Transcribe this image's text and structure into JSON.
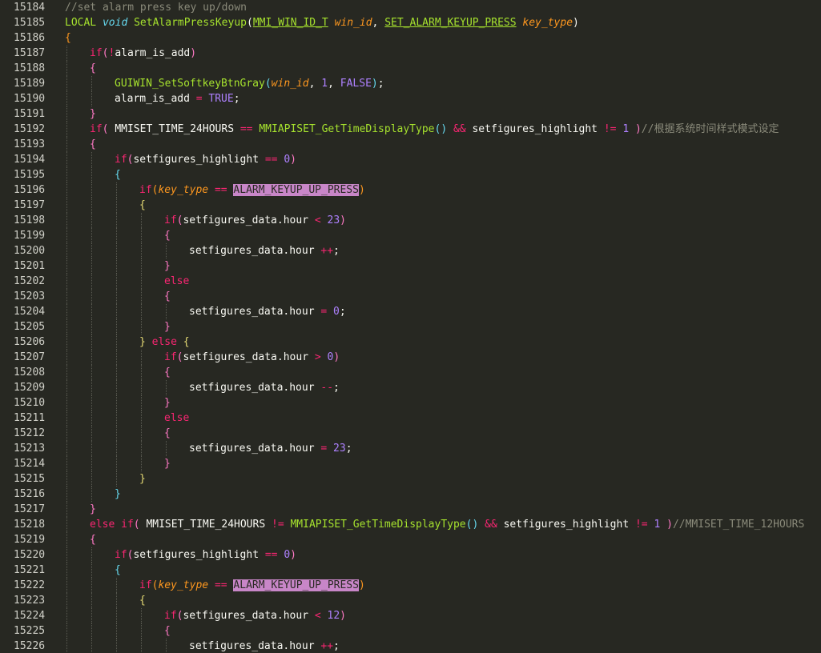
{
  "editor": {
    "lines": [
      {
        "num": "15184",
        "indent": 0,
        "tokens": [
          {
            "t": "//set alarm press key up/down",
            "c": "c"
          }
        ]
      },
      {
        "num": "15185",
        "indent": 0,
        "tokens": [
          {
            "t": "LOCAL ",
            "c": "f"
          },
          {
            "t": "void ",
            "c": "t"
          },
          {
            "t": "SetAlarmPressKeyup",
            "c": "f"
          },
          {
            "t": "(",
            "c": "w"
          },
          {
            "t": "MMI_WIN_ID_T",
            "c": "tu"
          },
          {
            "t": " ",
            "c": "w"
          },
          {
            "t": "win_id",
            "c": "p"
          },
          {
            "t": ", ",
            "c": "w"
          },
          {
            "t": "SET_ALARM_KEYUP_PRESS",
            "c": "tu"
          },
          {
            "t": " ",
            "c": "w"
          },
          {
            "t": "key_type",
            "c": "p"
          },
          {
            "t": ")",
            "c": "w"
          }
        ]
      },
      {
        "num": "15186",
        "indent": 0,
        "tokens": [
          {
            "t": "{",
            "c": "b"
          }
        ]
      },
      {
        "num": "15187",
        "indent": 1,
        "tokens": [
          {
            "t": "if",
            "c": "k"
          },
          {
            "t": "(",
            "c": "b2"
          },
          {
            "t": "!",
            "c": "k"
          },
          {
            "t": "alarm_is_add",
            "c": "w"
          },
          {
            "t": ")",
            "c": "b2"
          }
        ]
      },
      {
        "num": "15188",
        "indent": 1,
        "tokens": [
          {
            "t": "{",
            "c": "b2"
          }
        ]
      },
      {
        "num": "15189",
        "indent": 2,
        "tokens": [
          {
            "t": "GUIWIN_SetSoftkeyBtnGray",
            "c": "f"
          },
          {
            "t": "(",
            "c": "b3"
          },
          {
            "t": "win_id",
            "c": "p"
          },
          {
            "t": ", ",
            "c": "w"
          },
          {
            "t": "1",
            "c": "n"
          },
          {
            "t": ", ",
            "c": "w"
          },
          {
            "t": "FALSE",
            "c": "n"
          },
          {
            "t": ")",
            "c": "b3"
          },
          {
            "t": ";",
            "c": "w"
          }
        ]
      },
      {
        "num": "15190",
        "indent": 2,
        "tokens": [
          {
            "t": "alarm_is_add ",
            "c": "w"
          },
          {
            "t": "=",
            "c": "k"
          },
          {
            "t": " ",
            "c": "w"
          },
          {
            "t": "TRUE",
            "c": "n"
          },
          {
            "t": ";",
            "c": "w"
          }
        ]
      },
      {
        "num": "15191",
        "indent": 1,
        "tokens": [
          {
            "t": "}",
            "c": "b2"
          }
        ]
      },
      {
        "num": "15192",
        "indent": 1,
        "tokens": [
          {
            "t": "if",
            "c": "k"
          },
          {
            "t": "( ",
            "c": "b2"
          },
          {
            "t": "MMISET_TIME_24HOURS ",
            "c": "w"
          },
          {
            "t": "==",
            "c": "k"
          },
          {
            "t": " ",
            "c": "w"
          },
          {
            "t": "MMIAPISET_GetTimeDisplayType",
            "c": "f"
          },
          {
            "t": "()",
            "c": "b3"
          },
          {
            "t": " ",
            "c": "w"
          },
          {
            "t": "&&",
            "c": "k"
          },
          {
            "t": " setfigures_highlight ",
            "c": "w"
          },
          {
            "t": "!=",
            "c": "k"
          },
          {
            "t": " ",
            "c": "w"
          },
          {
            "t": "1",
            "c": "n"
          },
          {
            "t": " )",
            "c": "b2"
          },
          {
            "t": "//根据系统时间样式模式设定",
            "c": "c"
          }
        ]
      },
      {
        "num": "15193",
        "indent": 1,
        "tokens": [
          {
            "t": "{",
            "c": "b2"
          }
        ]
      },
      {
        "num": "15194",
        "indent": 2,
        "tokens": [
          {
            "t": "if",
            "c": "k"
          },
          {
            "t": "(",
            "c": "b2"
          },
          {
            "t": "setfigures_highlight ",
            "c": "w"
          },
          {
            "t": "==",
            "c": "k"
          },
          {
            "t": " ",
            "c": "w"
          },
          {
            "t": "0",
            "c": "n"
          },
          {
            "t": ")",
            "c": "b2"
          }
        ]
      },
      {
        "num": "15195",
        "indent": 2,
        "tokens": [
          {
            "t": "{",
            "c": "b3"
          }
        ]
      },
      {
        "num": "15196",
        "indent": 3,
        "tokens": [
          {
            "t": "if",
            "c": "k"
          },
          {
            "t": "(",
            "c": "b"
          },
          {
            "t": "key_type",
            "c": "p"
          },
          {
            "t": " ",
            "c": "w"
          },
          {
            "t": "==",
            "c": "k"
          },
          {
            "t": " ",
            "c": "w"
          },
          {
            "t": "ALARM_KEYUP_UP_PRESS",
            "c": "hl"
          },
          {
            "t": ")",
            "c": "b"
          }
        ]
      },
      {
        "num": "15197",
        "indent": 3,
        "tokens": [
          {
            "t": "{",
            "c": "b4"
          }
        ]
      },
      {
        "num": "15198",
        "indent": 4,
        "tokens": [
          {
            "t": "if",
            "c": "k"
          },
          {
            "t": "(",
            "c": "b2"
          },
          {
            "t": "setfigures_data.hour ",
            "c": "w"
          },
          {
            "t": "<",
            "c": "k"
          },
          {
            "t": " ",
            "c": "w"
          },
          {
            "t": "23",
            "c": "n"
          },
          {
            "t": ")",
            "c": "b2"
          }
        ]
      },
      {
        "num": "15199",
        "indent": 4,
        "tokens": [
          {
            "t": "{",
            "c": "b2"
          }
        ]
      },
      {
        "num": "15200",
        "indent": 5,
        "tokens": [
          {
            "t": "setfigures_data.hour ",
            "c": "w"
          },
          {
            "t": "++",
            "c": "k"
          },
          {
            "t": ";",
            "c": "w"
          }
        ]
      },
      {
        "num": "15201",
        "indent": 4,
        "tokens": [
          {
            "t": "}",
            "c": "b2"
          }
        ]
      },
      {
        "num": "15202",
        "indent": 4,
        "tokens": [
          {
            "t": "else",
            "c": "k"
          }
        ]
      },
      {
        "num": "15203",
        "indent": 4,
        "tokens": [
          {
            "t": "{",
            "c": "b2"
          }
        ]
      },
      {
        "num": "15204",
        "indent": 5,
        "tokens": [
          {
            "t": "setfigures_data.hour ",
            "c": "w"
          },
          {
            "t": "=",
            "c": "k"
          },
          {
            "t": " ",
            "c": "w"
          },
          {
            "t": "0",
            "c": "n"
          },
          {
            "t": ";",
            "c": "w"
          }
        ]
      },
      {
        "num": "15205",
        "indent": 4,
        "tokens": [
          {
            "t": "}",
            "c": "b2"
          }
        ]
      },
      {
        "num": "15206",
        "indent": 3,
        "tokens": [
          {
            "t": "}",
            "c": "b4"
          },
          {
            "t": " ",
            "c": "w"
          },
          {
            "t": "else",
            "c": "k"
          },
          {
            "t": " ",
            "c": "w"
          },
          {
            "t": "{",
            "c": "b4"
          }
        ]
      },
      {
        "num": "15207",
        "indent": 4,
        "tokens": [
          {
            "t": "if",
            "c": "k"
          },
          {
            "t": "(",
            "c": "b2"
          },
          {
            "t": "setfigures_data.hour ",
            "c": "w"
          },
          {
            "t": ">",
            "c": "k"
          },
          {
            "t": " ",
            "c": "w"
          },
          {
            "t": "0",
            "c": "n"
          },
          {
            "t": ")",
            "c": "b2"
          }
        ]
      },
      {
        "num": "15208",
        "indent": 4,
        "tokens": [
          {
            "t": "{",
            "c": "b2"
          }
        ]
      },
      {
        "num": "15209",
        "indent": 5,
        "tokens": [
          {
            "t": "setfigures_data.hour ",
            "c": "w"
          },
          {
            "t": "--",
            "c": "k"
          },
          {
            "t": ";",
            "c": "w"
          }
        ]
      },
      {
        "num": "15210",
        "indent": 4,
        "tokens": [
          {
            "t": "}",
            "c": "b2"
          }
        ]
      },
      {
        "num": "15211",
        "indent": 4,
        "tokens": [
          {
            "t": "else",
            "c": "k"
          }
        ]
      },
      {
        "num": "15212",
        "indent": 4,
        "tokens": [
          {
            "t": "{",
            "c": "b2"
          }
        ]
      },
      {
        "num": "15213",
        "indent": 5,
        "tokens": [
          {
            "t": "setfigures_data.hour ",
            "c": "w"
          },
          {
            "t": "=",
            "c": "k"
          },
          {
            "t": " ",
            "c": "w"
          },
          {
            "t": "23",
            "c": "n"
          },
          {
            "t": ";",
            "c": "w"
          }
        ]
      },
      {
        "num": "15214",
        "indent": 4,
        "tokens": [
          {
            "t": "}",
            "c": "b2"
          }
        ]
      },
      {
        "num": "15215",
        "indent": 3,
        "tokens": [
          {
            "t": "}",
            "c": "b4"
          }
        ]
      },
      {
        "num": "15216",
        "indent": 2,
        "tokens": [
          {
            "t": "}",
            "c": "b3"
          }
        ]
      },
      {
        "num": "15217",
        "indent": 1,
        "tokens": [
          {
            "t": "}",
            "c": "b2"
          }
        ]
      },
      {
        "num": "15218",
        "indent": 1,
        "tokens": [
          {
            "t": "else",
            "c": "k"
          },
          {
            "t": " ",
            "c": "w"
          },
          {
            "t": "if",
            "c": "k"
          },
          {
            "t": "( ",
            "c": "b2"
          },
          {
            "t": "MMISET_TIME_24HOURS ",
            "c": "w"
          },
          {
            "t": "!=",
            "c": "k"
          },
          {
            "t": " ",
            "c": "w"
          },
          {
            "t": "MMIAPISET_GetTimeDisplayType",
            "c": "f"
          },
          {
            "t": "()",
            "c": "b3"
          },
          {
            "t": " ",
            "c": "w"
          },
          {
            "t": "&&",
            "c": "k"
          },
          {
            "t": " setfigures_highlight ",
            "c": "w"
          },
          {
            "t": "!=",
            "c": "k"
          },
          {
            "t": " ",
            "c": "w"
          },
          {
            "t": "1",
            "c": "n"
          },
          {
            "t": " )",
            "c": "b2"
          },
          {
            "t": "//MMISET_TIME_12HOURS",
            "c": "c"
          }
        ]
      },
      {
        "num": "15219",
        "indent": 1,
        "tokens": [
          {
            "t": "{",
            "c": "b2"
          }
        ]
      },
      {
        "num": "15220",
        "indent": 2,
        "tokens": [
          {
            "t": "if",
            "c": "k"
          },
          {
            "t": "(",
            "c": "b2"
          },
          {
            "t": "setfigures_highlight ",
            "c": "w"
          },
          {
            "t": "==",
            "c": "k"
          },
          {
            "t": " ",
            "c": "w"
          },
          {
            "t": "0",
            "c": "n"
          },
          {
            "t": ")",
            "c": "b2"
          }
        ]
      },
      {
        "num": "15221",
        "indent": 2,
        "tokens": [
          {
            "t": "{",
            "c": "b3"
          }
        ]
      },
      {
        "num": "15222",
        "indent": 3,
        "tokens": [
          {
            "t": "if",
            "c": "k"
          },
          {
            "t": "(",
            "c": "b"
          },
          {
            "t": "key_type",
            "c": "p"
          },
          {
            "t": " ",
            "c": "w"
          },
          {
            "t": "==",
            "c": "k"
          },
          {
            "t": " ",
            "c": "w"
          },
          {
            "t": "ALARM_KEYUP_UP_PRESS",
            "c": "hl"
          },
          {
            "t": ")",
            "c": "b"
          }
        ]
      },
      {
        "num": "15223",
        "indent": 3,
        "tokens": [
          {
            "t": "{",
            "c": "b4"
          }
        ]
      },
      {
        "num": "15224",
        "indent": 4,
        "tokens": [
          {
            "t": "if",
            "c": "k"
          },
          {
            "t": "(",
            "c": "b2"
          },
          {
            "t": "setfigures_data.hour ",
            "c": "w"
          },
          {
            "t": "<",
            "c": "k"
          },
          {
            "t": " ",
            "c": "w"
          },
          {
            "t": "12",
            "c": "n"
          },
          {
            "t": ")",
            "c": "b2"
          }
        ]
      },
      {
        "num": "15225",
        "indent": 4,
        "tokens": [
          {
            "t": "{",
            "c": "b2"
          }
        ]
      },
      {
        "num": "15226",
        "indent": 5,
        "tokens": [
          {
            "t": "setfigures_data.hour ",
            "c": "w"
          },
          {
            "t": "++",
            "c": "k"
          },
          {
            "t": ";",
            "c": "w"
          }
        ]
      }
    ]
  }
}
